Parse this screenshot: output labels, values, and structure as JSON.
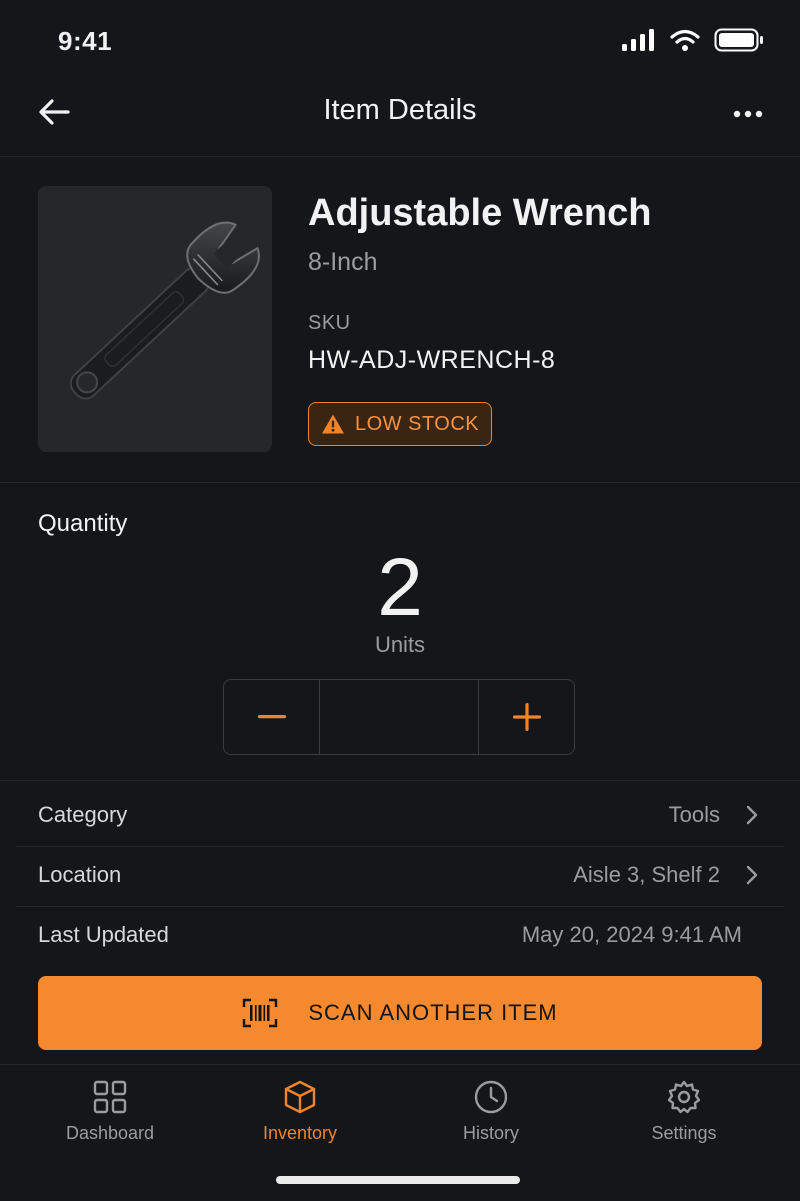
{
  "status_bar": {
    "time": "9:41"
  },
  "nav": {
    "title": "Item Details"
  },
  "item": {
    "name": "Adjustable Wrench",
    "variant": "8-Inch",
    "sku_label": "SKU",
    "sku": "HW-ADJ-WRENCH-8",
    "stock_badge": "LOW STOCK"
  },
  "quantity": {
    "label": "Quantity",
    "value": "2",
    "unit": "Units"
  },
  "details": [
    {
      "label": "Category",
      "value": "Tools"
    },
    {
      "label": "Location",
      "value": "Aisle 3, Shelf 2"
    },
    {
      "label": "Last Updated",
      "value": "May 20, 2024 9:41 AM"
    }
  ],
  "scan_button": {
    "label": "SCAN ANOTHER ITEM"
  },
  "tabs": [
    {
      "label": "Dashboard",
      "icon": "grid-icon",
      "active": false
    },
    {
      "label": "Inventory",
      "icon": "box-icon",
      "active": true
    },
    {
      "label": "History",
      "icon": "clock-icon",
      "active": false
    },
    {
      "label": "Settings",
      "icon": "gear-icon",
      "active": false
    }
  ],
  "colors": {
    "accent": "#f0842a",
    "background": "#151619",
    "text_secondary": "#9a9ca1"
  }
}
